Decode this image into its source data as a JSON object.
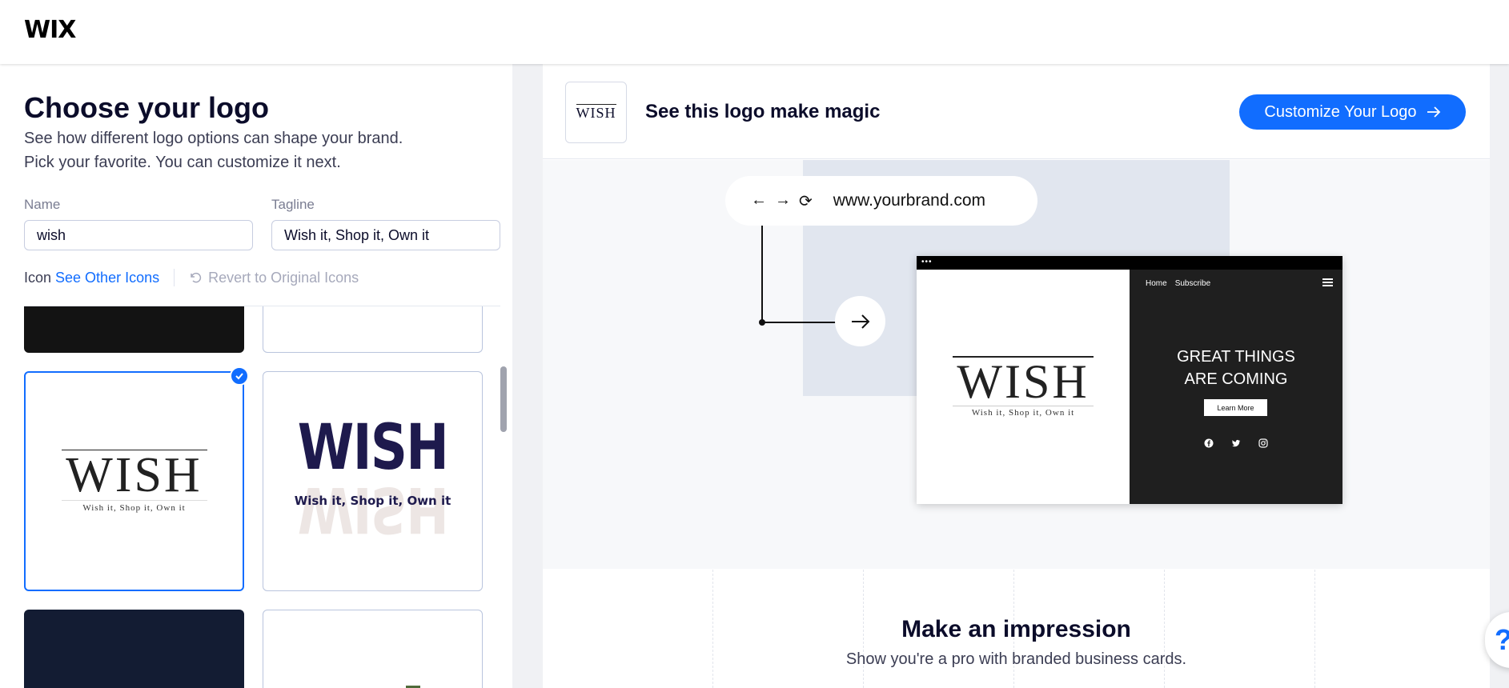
{
  "header": {
    "brand": "WIX"
  },
  "left": {
    "title": "Choose your logo",
    "subtitle_line1": "See how different logo options can shape your brand.",
    "subtitle_line2": "Pick your favorite. You can customize it next.",
    "name_label": "Name",
    "name_value": "wish",
    "tagline_label": "Tagline",
    "tagline_value": "Wish it, Shop it, Own it",
    "icon_label": "Icon",
    "see_other_icons": "See Other Icons",
    "revert_icons": "Revert to Original Icons",
    "logos": [
      {
        "word": "WISH",
        "tagline": "Wish it, Shop it, Own it",
        "selected": true
      },
      {
        "word": "WISH",
        "tagline": "Wish it, Shop it, Own it",
        "selected": false
      }
    ]
  },
  "right": {
    "thumb_word": "WISH",
    "heading": "See this logo make magic",
    "cta_label": "Customize Your Logo",
    "url": "www.yourbrand.com",
    "site": {
      "dots": "•••",
      "nav_home": "Home",
      "nav_subscribe": "Subscribe",
      "word": "WISH",
      "tagline": "Wish it, Shop it, Own it",
      "headline_line1": "GREAT THINGS",
      "headline_line2": "ARE COMING",
      "learn_more": "Learn More"
    },
    "impress_title": "Make an impression",
    "impress_sub": "Show you're a pro with branded business cards."
  },
  "help_label": "?",
  "colors": {
    "accent": "#116dff",
    "navy": "#1e1a4d",
    "dark_card": "#131c33"
  }
}
